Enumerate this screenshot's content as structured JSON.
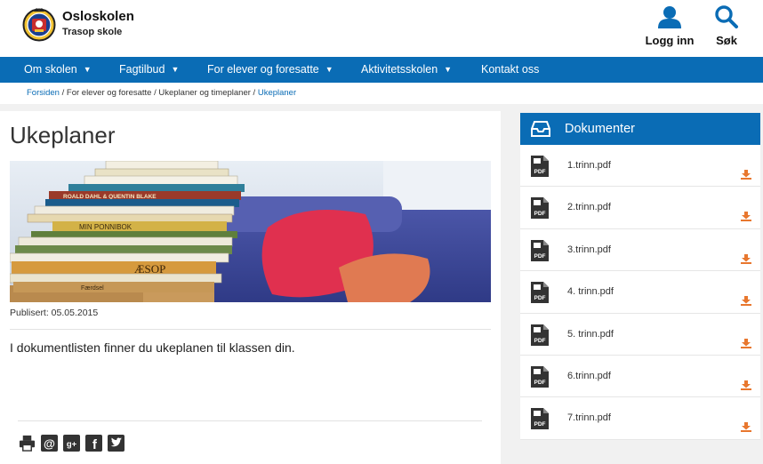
{
  "header": {
    "site_name": "Osloskolen",
    "site_sub": "Trasop skole",
    "login_label": "Logg inn",
    "search_label": "Søk"
  },
  "nav": {
    "items": [
      {
        "label": "Om skolen",
        "dropdown": true
      },
      {
        "label": "Fagtilbud",
        "dropdown": true
      },
      {
        "label": "For elever og foresatte",
        "dropdown": true
      },
      {
        "label": "Aktivitetsskolen",
        "dropdown": true
      },
      {
        "label": "Kontakt oss",
        "dropdown": false
      }
    ]
  },
  "breadcrumb": {
    "items": [
      "Forsiden",
      "For elever og foresatte",
      "Ukeplaner og timeplaner",
      "Ukeplaner"
    ],
    "separator": " / "
  },
  "main": {
    "title": "Ukeplaner",
    "published": "Publisert: 05.05.2015",
    "intro": "I dokumentlisten finner du ukeplanen til klassen din.",
    "book_titles": [
      "ROALD DAHL & QUENTIN BLAKE",
      "MIN PONNIBOK",
      "ÆSOP",
      "Færdsel"
    ]
  },
  "share": {
    "icons": [
      "print-icon",
      "email-icon",
      "google-plus-icon",
      "facebook-icon",
      "twitter-icon"
    ]
  },
  "documents": {
    "title": "Dokumenter",
    "items": [
      "1.trinn.pdf",
      "2.trinn.pdf",
      "3.trinn.pdf",
      "4. trinn.pdf",
      "5. trinn.pdf",
      "6.trinn.pdf",
      "7.trinn.pdf"
    ]
  },
  "colors": {
    "brand_blue": "#0a6cb5",
    "download_orange": "#e8772e"
  }
}
